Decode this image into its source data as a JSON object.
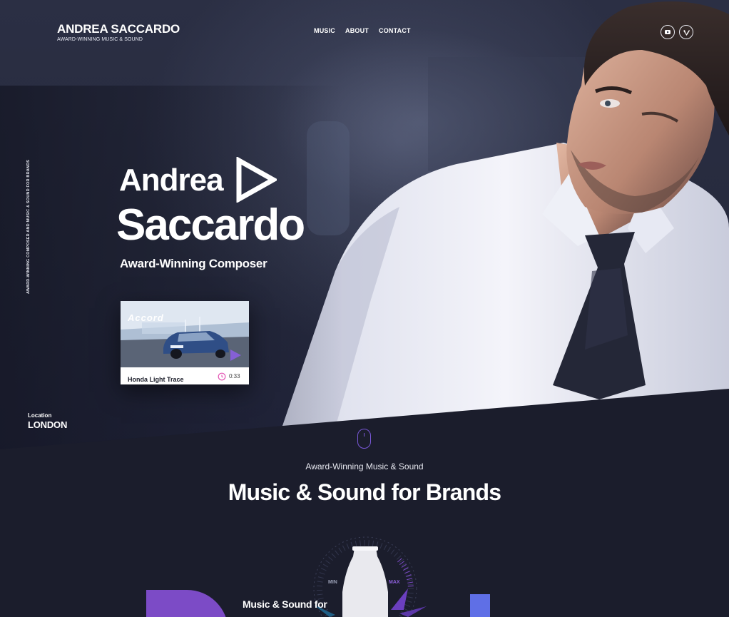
{
  "header": {
    "brand_name": "ANDREA SACCARDO",
    "brand_tagline": "AWARD-WINNING MUSIC & SOUND",
    "nav": [
      "MUSIC",
      "ABOUT",
      "CONTACT"
    ],
    "social": [
      "youtube-icon",
      "vimeo-icon"
    ]
  },
  "side_text": "AWARD-WINNING COMPOSER AND MUSIC & SOUND FOR BRANDS",
  "hero": {
    "first_name": "Andrea",
    "last_name": "Saccardo",
    "subtitle": "Award-Winning Composer"
  },
  "featured": {
    "title": "Honda Light Trace",
    "duration": "0:33",
    "thumbnail_text": "Accord"
  },
  "location": {
    "label": "Location",
    "value": "LONDON"
  },
  "section": {
    "kicker": "Award-Winning Music & Sound",
    "headline": "Music & Sound for Brands",
    "lower_text": "Music & Sound for",
    "dial_min": "MIN",
    "dial_max": "MAX"
  },
  "colors": {
    "background": "#1b1d2c",
    "accent_purple": "#7c4bc6",
    "accent_blue": "#5f6fe6",
    "clock_pink": "#e455b4"
  }
}
